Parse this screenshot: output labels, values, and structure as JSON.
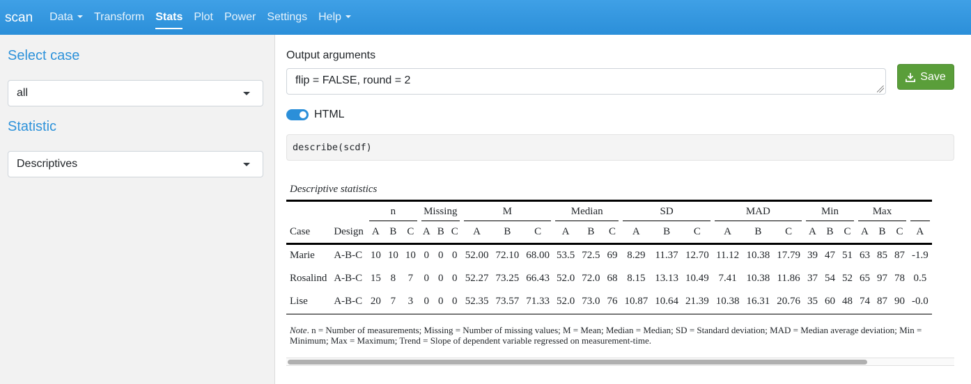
{
  "navbar": {
    "brand": "scan",
    "items": [
      {
        "label": "Data",
        "dropdown": true
      },
      {
        "label": "Transform",
        "dropdown": false
      },
      {
        "label": "Stats",
        "dropdown": false,
        "active": true
      },
      {
        "label": "Plot",
        "dropdown": false
      },
      {
        "label": "Power",
        "dropdown": false
      },
      {
        "label": "Settings",
        "dropdown": false
      },
      {
        "label": "Help",
        "dropdown": true
      }
    ]
  },
  "sidebar": {
    "select_case_heading": "Select case",
    "case_value": "all",
    "statistic_heading": "Statistic",
    "statistic_value": "Descriptives"
  },
  "main": {
    "output_args_label": "Output arguments",
    "output_args_value": "flip = FALSE, round = 2",
    "save_label": "Save",
    "html_toggle_label": "HTML",
    "html_toggle_on": true,
    "code": "describe(scdf)"
  },
  "table": {
    "caption": "Descriptive statistics",
    "groups": [
      "n",
      "Missing",
      "M",
      "Median",
      "SD",
      "MAD",
      "Min",
      "Max"
    ],
    "sub_headers": [
      "Case",
      "Design",
      "A",
      "B",
      "C",
      "A",
      "B",
      "C",
      "A",
      "B",
      "C",
      "A",
      "B",
      "C",
      "A",
      "B",
      "C",
      "A",
      "B",
      "C",
      "A",
      "B",
      "C",
      "A",
      "B",
      "C",
      "A"
    ],
    "rows": [
      [
        "Marie",
        "A-B-C",
        "10",
        "10",
        "10",
        "0",
        "0",
        "0",
        "52.00",
        "72.10",
        "68.00",
        "53.5",
        "72.5",
        "69",
        "8.29",
        "11.37",
        "12.70",
        "11.12",
        "10.38",
        "17.79",
        "39",
        "47",
        "51",
        "63",
        "85",
        "87",
        "-1.9"
      ],
      [
        "Rosalind",
        "A-B-C",
        "15",
        "8",
        "7",
        "0",
        "0",
        "0",
        "52.27",
        "73.25",
        "66.43",
        "52.0",
        "72.0",
        "68",
        "8.15",
        "13.13",
        "10.49",
        "7.41",
        "10.38",
        "11.86",
        "37",
        "54",
        "52",
        "65",
        "97",
        "78",
        "0.5"
      ],
      [
        "Lise",
        "A-B-C",
        "20",
        "7",
        "3",
        "0",
        "0",
        "0",
        "52.35",
        "73.57",
        "71.33",
        "52.0",
        "73.0",
        "76",
        "10.87",
        "10.64",
        "21.39",
        "10.38",
        "16.31",
        "20.76",
        "35",
        "60",
        "48",
        "74",
        "87",
        "90",
        "-0.0"
      ]
    ],
    "note_label": "Note",
    "note_line1": ". n = Number of measurements; Missing = Number of missing values; M = Mean; Median = Median; SD = Standard deviation; MAD = Median average deviation; Min =",
    "note_line2": "Minimum; Max = Maximum; Trend = Slope of dependent variable regressed on measurement-time."
  },
  "colors": {
    "navbar": "#2b8fd9",
    "accent": "#2d92da",
    "save_button": "#5a9e3a"
  }
}
